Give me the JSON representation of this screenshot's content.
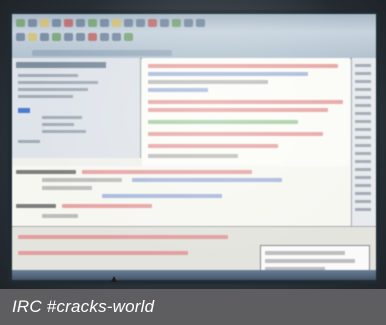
{
  "caption": {
    "text": "IRC #cracks-world"
  },
  "photo": {
    "subject": "monitor-photo",
    "colors": {
      "caption_bg": "#5e5e60",
      "caption_text": "#ffffff",
      "screen_bg": "#f0f1ed",
      "toolbar": "#b2c2cf",
      "selection": "#4b7bd0"
    }
  }
}
